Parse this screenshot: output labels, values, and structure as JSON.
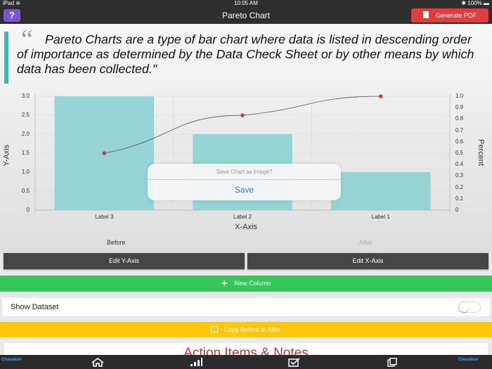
{
  "status_bar": {
    "device": "iPad",
    "wifi": "≋",
    "time": "10:05 AM",
    "battery": "100%"
  },
  "nav": {
    "help_label": "?",
    "title": "Pareto Chart",
    "pdf_label": "Generate PDF"
  },
  "quote": {
    "mark": "“",
    "text": "Pareto Charts are a type of bar chart where data is listed in descending order of importance as determined by the Data Check Sheet or by other means by which data has been collected.\""
  },
  "chart_data": {
    "type": "bar",
    "categories": [
      "Label 3",
      "Label 2",
      "Label 1"
    ],
    "values": [
      3.0,
      2.0,
      1.0
    ],
    "cumulative_percent": [
      0.5,
      0.833,
      1.0
    ],
    "xlabel": "X-Axis",
    "ylabel": "Y-Axis",
    "y2label": "Percent",
    "ylim": [
      0,
      3
    ],
    "y2lim": [
      0,
      1
    ],
    "y_ticks": [
      "0",
      "0.5",
      "1.0",
      "1.5",
      "2.0",
      "2.5",
      "3.0"
    ],
    "y2_ticks": [
      "0",
      "0.1",
      "0.2",
      "0.3",
      "0.4",
      "0.5",
      "0.6",
      "0.7",
      "0.8",
      "0.9",
      "1.0"
    ],
    "grid": true,
    "bar_color": "#8dd3d2",
    "line_color": "#555555",
    "point_color": "#cc3b3b"
  },
  "segments": {
    "before": "Before",
    "after": "After"
  },
  "popup": {
    "title": "Save Chart as Image?",
    "save_label": "Save"
  },
  "buttons": {
    "edit_y": "Edit Y-Axis",
    "edit_x": "Edit X-Axis",
    "new_column": "New Column",
    "copy": "Copy Before to After"
  },
  "dataset": {
    "label": "Show Dataset",
    "toggle_on": false
  },
  "action": {
    "title": "Action Items & Notes"
  },
  "tabbar": {
    "ad_left": "Chavakon",
    "ad_right": "Chavakon"
  },
  "colors": {
    "accent_teal": "#3ab8b3",
    "green": "#35c75a",
    "yellow": "#fdc80a",
    "red": "#e23c3c",
    "purple": "#7b56cf"
  }
}
